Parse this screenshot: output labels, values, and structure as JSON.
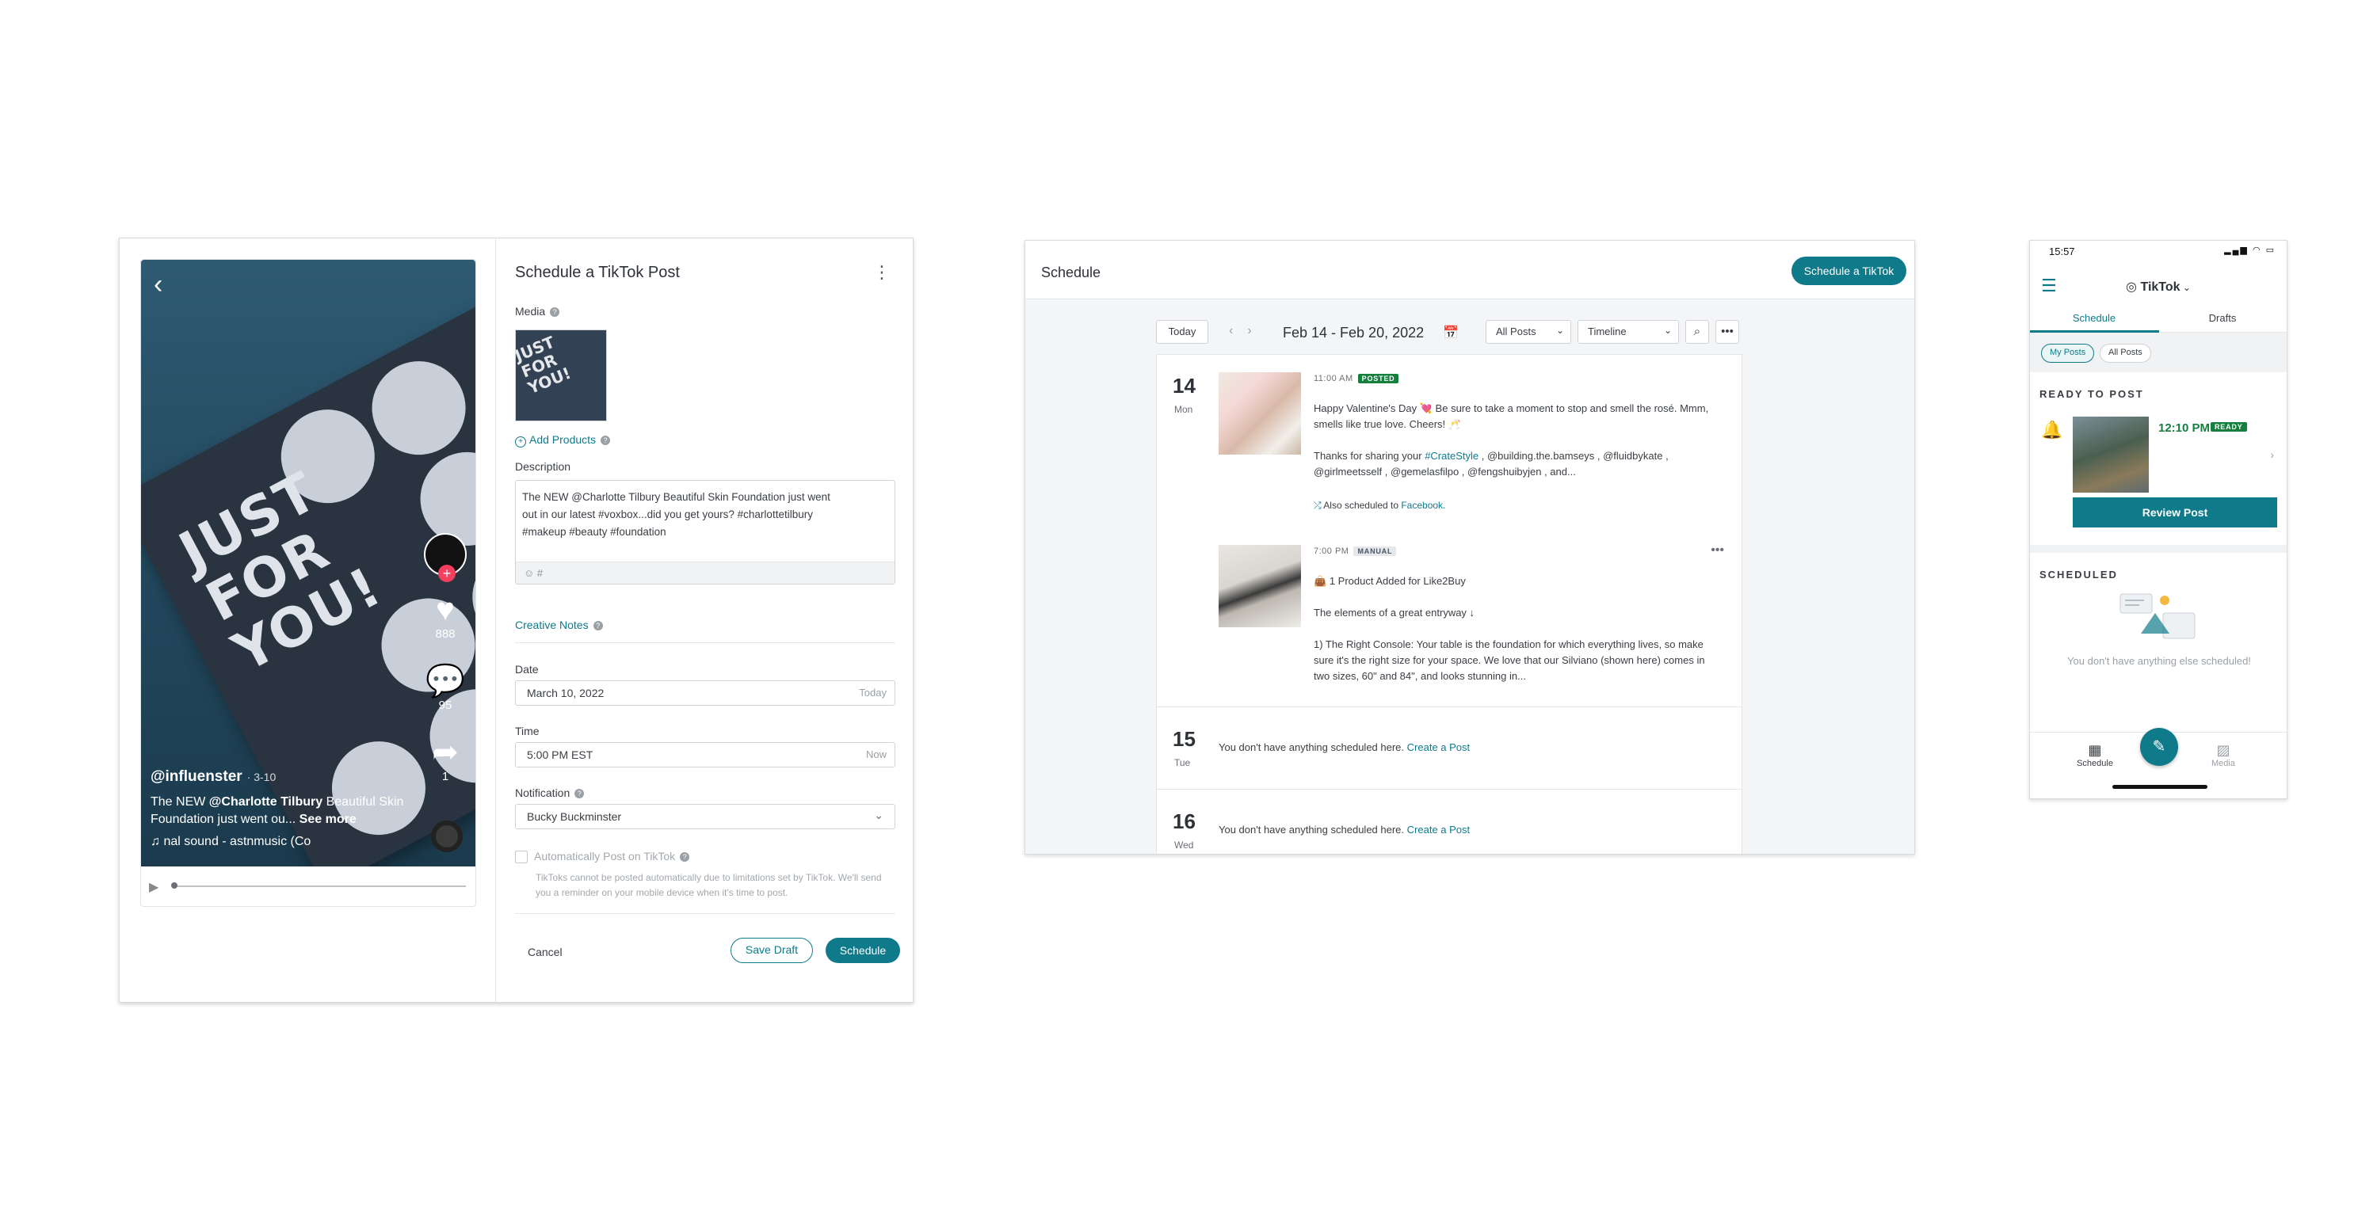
{
  "modal": {
    "title": "Schedule a TikTok Post",
    "media_label": "Media",
    "add_products": "Add Products",
    "description_label": "Description",
    "description": "The NEW @Charlotte Tilbury Beautiful Skin Foundation just went out in our latest #voxbox...did you get yours? #charlottetilbury #makeup #beauty #foundation",
    "desc_toolbar": "☺   #",
    "creative_notes": "Creative Notes",
    "date_label": "Date",
    "date_value": "March 10, 2022",
    "date_shortcut": "Today",
    "time_label": "Time",
    "time_value": "5:00 PM EST",
    "time_shortcut": "Now",
    "notification_label": "Notification",
    "notification_value": "Bucky Buckminster",
    "auto_post_label": "Automatically Post on TikTok",
    "auto_post_note": "TikToks cannot be posted automatically due to limitations set by TikTok. We'll send you a reminder on your mobile device when it's time to post.",
    "cancel": "Cancel",
    "save_draft": "Save Draft",
    "schedule": "Schedule"
  },
  "preview": {
    "box_text": "JUST\nFOR\nYOU!",
    "thumb_text": "JUST\nFOR\nYOU!",
    "likes": "888",
    "comments": "95",
    "shares": "1",
    "username": "@influenster",
    "date": "· 3-10",
    "caption_prefix": "The NEW ",
    "caption_mention": "@Charlotte Tilbury",
    "caption_rest": " Beautiful Skin Foundation just went ou...",
    "see_more": " See more",
    "sound": "♫  nal sound - astnmusic (Co"
  },
  "schedule": {
    "title": "Schedule",
    "cta": "Schedule a TikTok",
    "today": "Today",
    "range": "Feb 14 - Feb 20, 2022",
    "filter": "All Posts",
    "view": "Timeline",
    "days": [
      {
        "num": "14",
        "name": "Mon",
        "posts": [
          {
            "time": "11:00 AM",
            "badge": "POSTED",
            "text": "Happy Valentine's Day 💘 Be sure to take a moment to stop and smell the rosé. Mmm, smells like true love. Cheers! 🥂",
            "thanks_prefix": "Thanks for sharing your ",
            "hashtag": "#CrateStyle",
            "thanks_rest": " , @building.the.bamseys , @fluidbykate , @girlmeetsself , @gemelasfilpo , @fengshuibyjen , and...",
            "also_prefix": "Also scheduled to ",
            "also_network": "Facebook."
          },
          {
            "time": "7:00 PM",
            "badge": "MANUAL",
            "products": "1 Product Added for Like2Buy",
            "headline": "The elements of a great entryway ↓",
            "text": "1) The Right Console: Your table is the foundation for which everything lives, so make sure it's the right size for your space. We love that our Silviano (shown here) comes in two sizes, 60\" and 84\", and looks stunning in..."
          }
        ]
      },
      {
        "num": "15",
        "name": "Tue",
        "empty": "You don't have anything scheduled here.",
        "create": "Create a Post"
      },
      {
        "num": "16",
        "name": "Wed",
        "empty": "You don't have anything scheduled here.",
        "create": "Create a Post"
      }
    ]
  },
  "mobile": {
    "time": "15:57",
    "account": "TikTok",
    "tab_schedule": "Schedule",
    "tab_drafts": "Drafts",
    "chip_my": "My Posts",
    "chip_all": "All Posts",
    "ready_title": "READY TO POST",
    "post_time": "12:10 PM",
    "ready_badge": "READY",
    "review": "Review Post",
    "scheduled_title": "SCHEDULED",
    "empty": "You don't have anything else scheduled!",
    "nav_schedule": "Schedule",
    "nav_media": "Media"
  },
  "colors": {
    "accent": "#0f7a8a",
    "posted": "#15803d"
  }
}
